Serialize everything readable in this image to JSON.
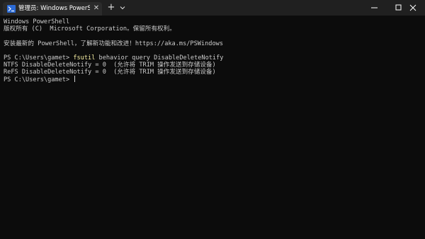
{
  "window": {
    "tab_title": "管理员: Windows PowerShe",
    "tab_close": "✕",
    "new_tab": "+",
    "icons": {
      "tab": "powershell-icon",
      "dropdown": "chevron-down-icon",
      "minimize": "minimize-icon",
      "maximize": "maximize-icon",
      "close": "close-icon"
    }
  },
  "terminal": {
    "header_title": "Windows PowerShell",
    "copyright": "版权所有 (C)  Microsoft Corporation。保留所有权利。",
    "install_msg": "安装最新的 PowerShell，了解新功能和改进！https://aka.ms/PSWindows",
    "prompt1": "PS C:\\Users\\gamet> ",
    "command_name": "fsutil",
    "command_args": " behavior query DisableDeleteNotify",
    "output_ntfs": "NTFS DisableDeleteNotify = 0  (允许将 TRIM 操作发送到存储设备)",
    "output_refs": "ReFS DisableDeleteNotify = 0  (允许将 TRIM 操作发送到存储设备)",
    "prompt2": "PS C:\\Users\\gamet> "
  },
  "colors": {
    "background": "#0c0c0c",
    "titlebar": "#202020",
    "text": "#cccccc",
    "command": "#f9f1a5"
  }
}
